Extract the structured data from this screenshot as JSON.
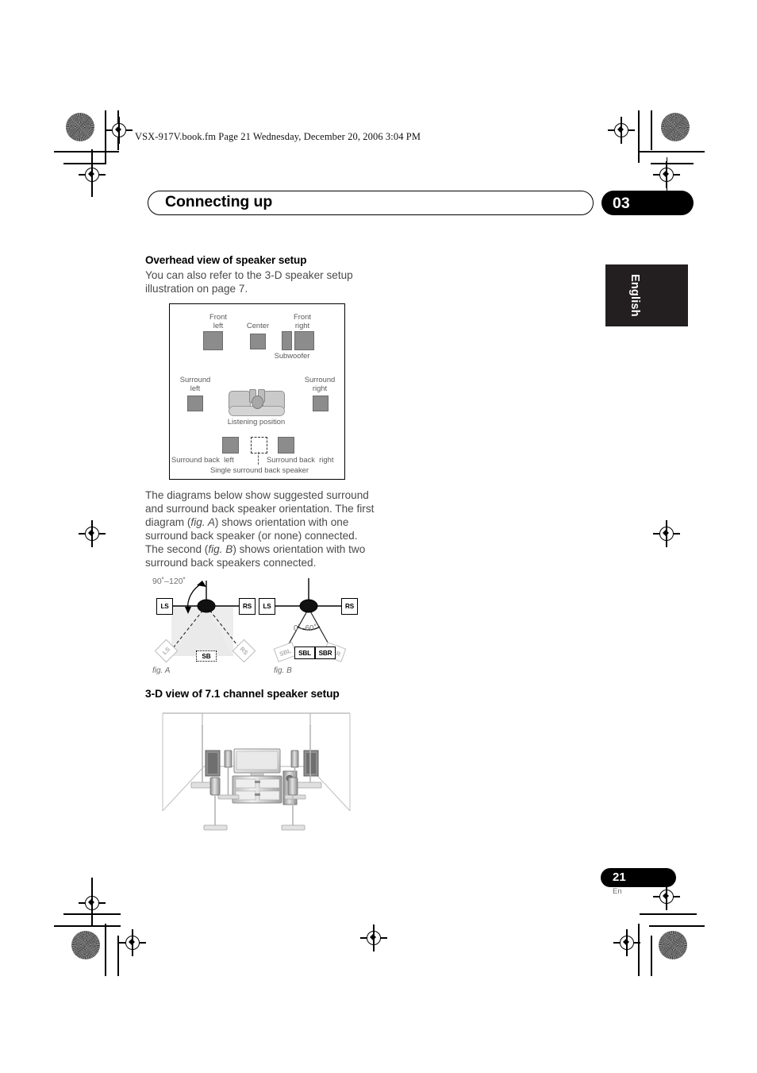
{
  "header": {
    "file_line": "VSX-917V.book.fm  Page 21  Wednesday, December 20, 2006  3:04 PM",
    "chapter_title": "Connecting up",
    "chapter_number": "03",
    "language_tab": "English"
  },
  "sections": {
    "overhead": {
      "heading": "Overhead view of speaker setup",
      "intro": "You can also refer to the 3-D speaker setup illustration on page 7.",
      "diagram_labels": {
        "front_left": "Front\nleft",
        "front_left_line1": "Front",
        "front_left_line2": "left",
        "center": "Center",
        "front_right_line1": "Front",
        "front_right_line2": "right",
        "subwoofer": "Subwoofer",
        "surround_left_line1": "Surround",
        "surround_left_line2": "left",
        "surround_right_line1": "Surround",
        "surround_right_line2": "right",
        "listening_position": "Listening position",
        "surround_back_left": "Surround back  left",
        "surround_back_right": "Surround back  right",
        "single_surround_back": "Single surround back speaker"
      }
    },
    "diagrams_para": {
      "l1": "The diagrams below show suggested surround",
      "l2": "and surround back speaker orientation. The",
      "l3a": "first diagram (",
      "l3b": "fig. A",
      "l3c": ") shows orientation with one",
      "l4": "surround back speaker (or none) connected.",
      "l5a": "The second (",
      "l5b": "fig. B",
      "l5c": ") shows orientation with two",
      "l6": "surround back speakers connected."
    },
    "fig_a": {
      "caption": "fig. A",
      "angle": "90˚–120˚",
      "ls_top": "LS",
      "rs_top": "RS",
      "ls_bottom": "LS",
      "rs_bottom": "RS",
      "sb": "SB"
    },
    "fig_b": {
      "caption": "fig. B",
      "angle": "0˚–60˚",
      "ls_top": "LS",
      "rs_top": "RS",
      "sbl_ghost": "SBL",
      "sbr_ghost": "SBR",
      "sbl": "SBL",
      "sbr": "SBR"
    },
    "three_d": {
      "heading": "3-D view of 7.1 channel speaker setup"
    }
  },
  "footer": {
    "page_number": "21",
    "page_language": "En"
  },
  "colors": {
    "ink": "#231f20",
    "body_text": "#4a4a4a",
    "speaker_fill": "#8c8c8c",
    "label_grey": "#595959"
  }
}
